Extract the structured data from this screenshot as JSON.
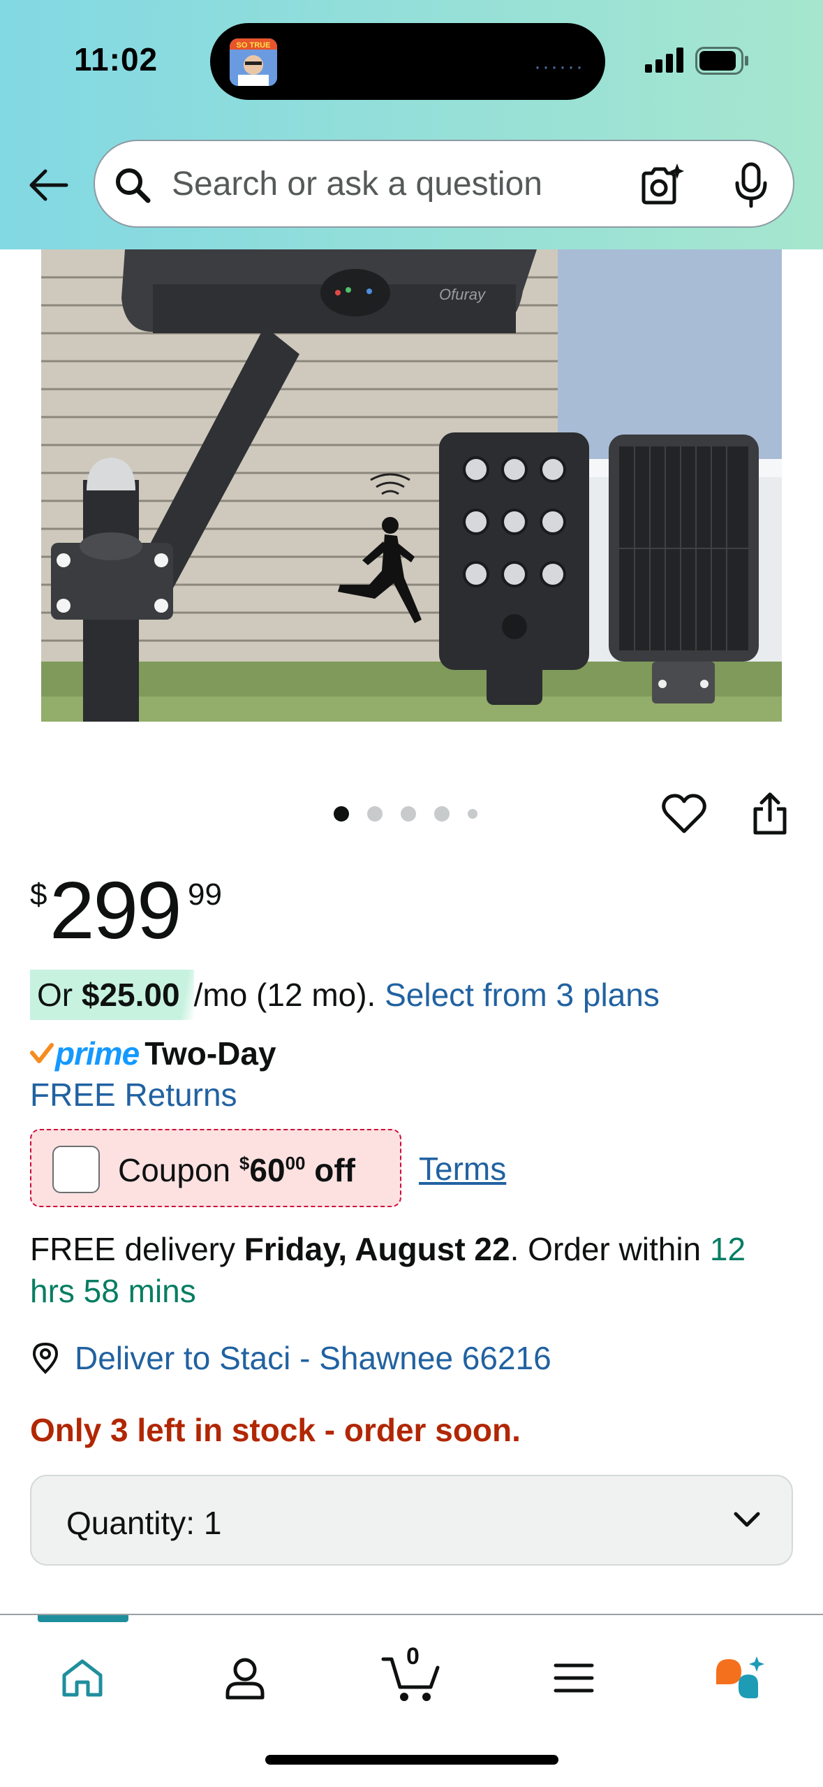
{
  "status_bar": {
    "time": "11:02",
    "island_badge": "SO TRUE"
  },
  "search": {
    "placeholder": "Search or ask a question"
  },
  "product": {
    "image_brand": "Ofuray",
    "image_count": 5,
    "active_image_index": 1,
    "price": {
      "symbol": "$",
      "whole": "299",
      "fraction": "99"
    },
    "monthly": {
      "prefix": "Or",
      "amount": "$25.00",
      "suffix": "/mo (12 mo).",
      "link": "Select from 3 plans"
    },
    "prime": {
      "brand": "prime",
      "speed": "Two-Day"
    },
    "free_returns": "FREE Returns",
    "coupon": {
      "label": "Coupon",
      "symbol": "$",
      "amount": "60",
      "cents": "00",
      "suffix": "off",
      "terms": "Terms"
    },
    "delivery": {
      "prefix": "FREE delivery",
      "date": "Friday, August 22",
      "middle": ". Order within",
      "countdown": "12 hrs 58 mins"
    },
    "deliver_to": "Deliver to Staci - Shawnee 66216",
    "stock": "Only 3 left in stock - order soon.",
    "quantity": {
      "label": "Quantity:",
      "value": "1"
    }
  },
  "tabbar": {
    "cart_count": "0",
    "active_tab": "home",
    "accent_color": "#1f8e9c"
  },
  "colors": {
    "link": "#2162a1",
    "stock_alert": "#b12704",
    "countdown": "#067d62",
    "prime_blue": "#1399ff",
    "coupon_border": "#cc0c39"
  }
}
